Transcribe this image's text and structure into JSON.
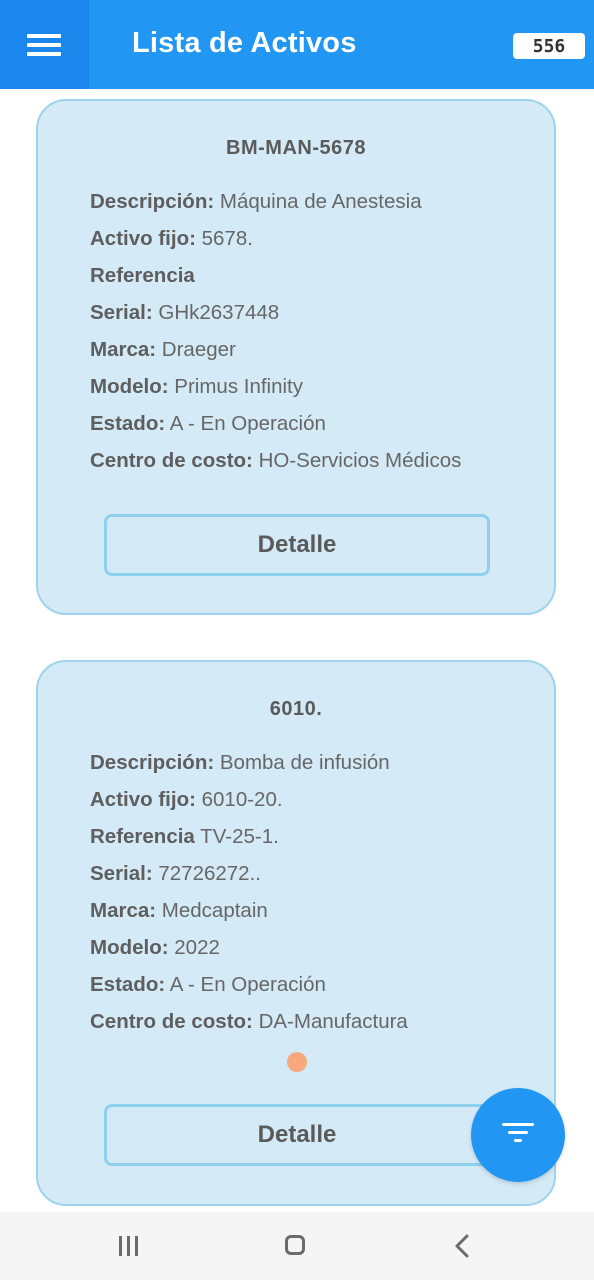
{
  "app": {
    "title": "Lista de Activos",
    "count": "556",
    "accent": "#2196f3"
  },
  "cards": [
    {
      "title": "BM-MAN-5678",
      "fields": [
        {
          "label": "Descripción:",
          "value": "Máquina de Anestesia"
        },
        {
          "label": "Activo fijo:",
          "value": "5678."
        },
        {
          "label": "Referencia",
          "value": ""
        },
        {
          "label": "Serial:",
          "value": "GHk2637448"
        },
        {
          "label": "Marca:",
          "value": "Draeger"
        },
        {
          "label": "Modelo:",
          "value": "Primus Infinity"
        },
        {
          "label": "Estado:",
          "value": "A - En Operación"
        },
        {
          "label": "Centro de costo:",
          "value": "HO-Servicios Médicos"
        }
      ],
      "button_label": "Detalle"
    },
    {
      "title": "6010.",
      "fields": [
        {
          "label": "Descripción:",
          "value": "Bomba de infusión"
        },
        {
          "label": "Activo fijo:",
          "value": "6010-20."
        },
        {
          "label": "Referencia",
          "value": "TV-25-1."
        },
        {
          "label": "Serial:",
          "value": "72726272.."
        },
        {
          "label": "Marca:",
          "value": "Medcaptain"
        },
        {
          "label": "Modelo:",
          "value": "2022"
        },
        {
          "label": "Estado:",
          "value": "A - En Operación"
        },
        {
          "label": "Centro de costo:",
          "value": "DA-Manufactura"
        }
      ],
      "button_label": "Detalle"
    }
  ],
  "icons": {
    "menu": "hamburger-menu-icon",
    "fab": "filter-icon",
    "nav_recents": "recent-apps-icon",
    "nav_home": "home-icon",
    "nav_back": "back-icon"
  }
}
